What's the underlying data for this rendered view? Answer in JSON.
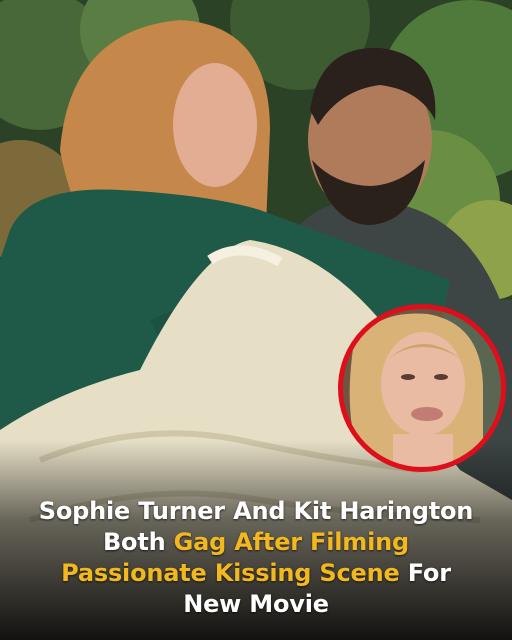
{
  "headline": {
    "line1": "Sophie Turner And Kit Harington",
    "line2_pre": "Both ",
    "line2_highlight": "Gag After Filming",
    "line3_highlight": "Passionate Kissing Scene",
    "line3_post": " For",
    "line4": "New Movie"
  },
  "colors": {
    "highlight": "#f2b81d",
    "text": "#ffffff",
    "circle_border": "#e00d1a"
  }
}
